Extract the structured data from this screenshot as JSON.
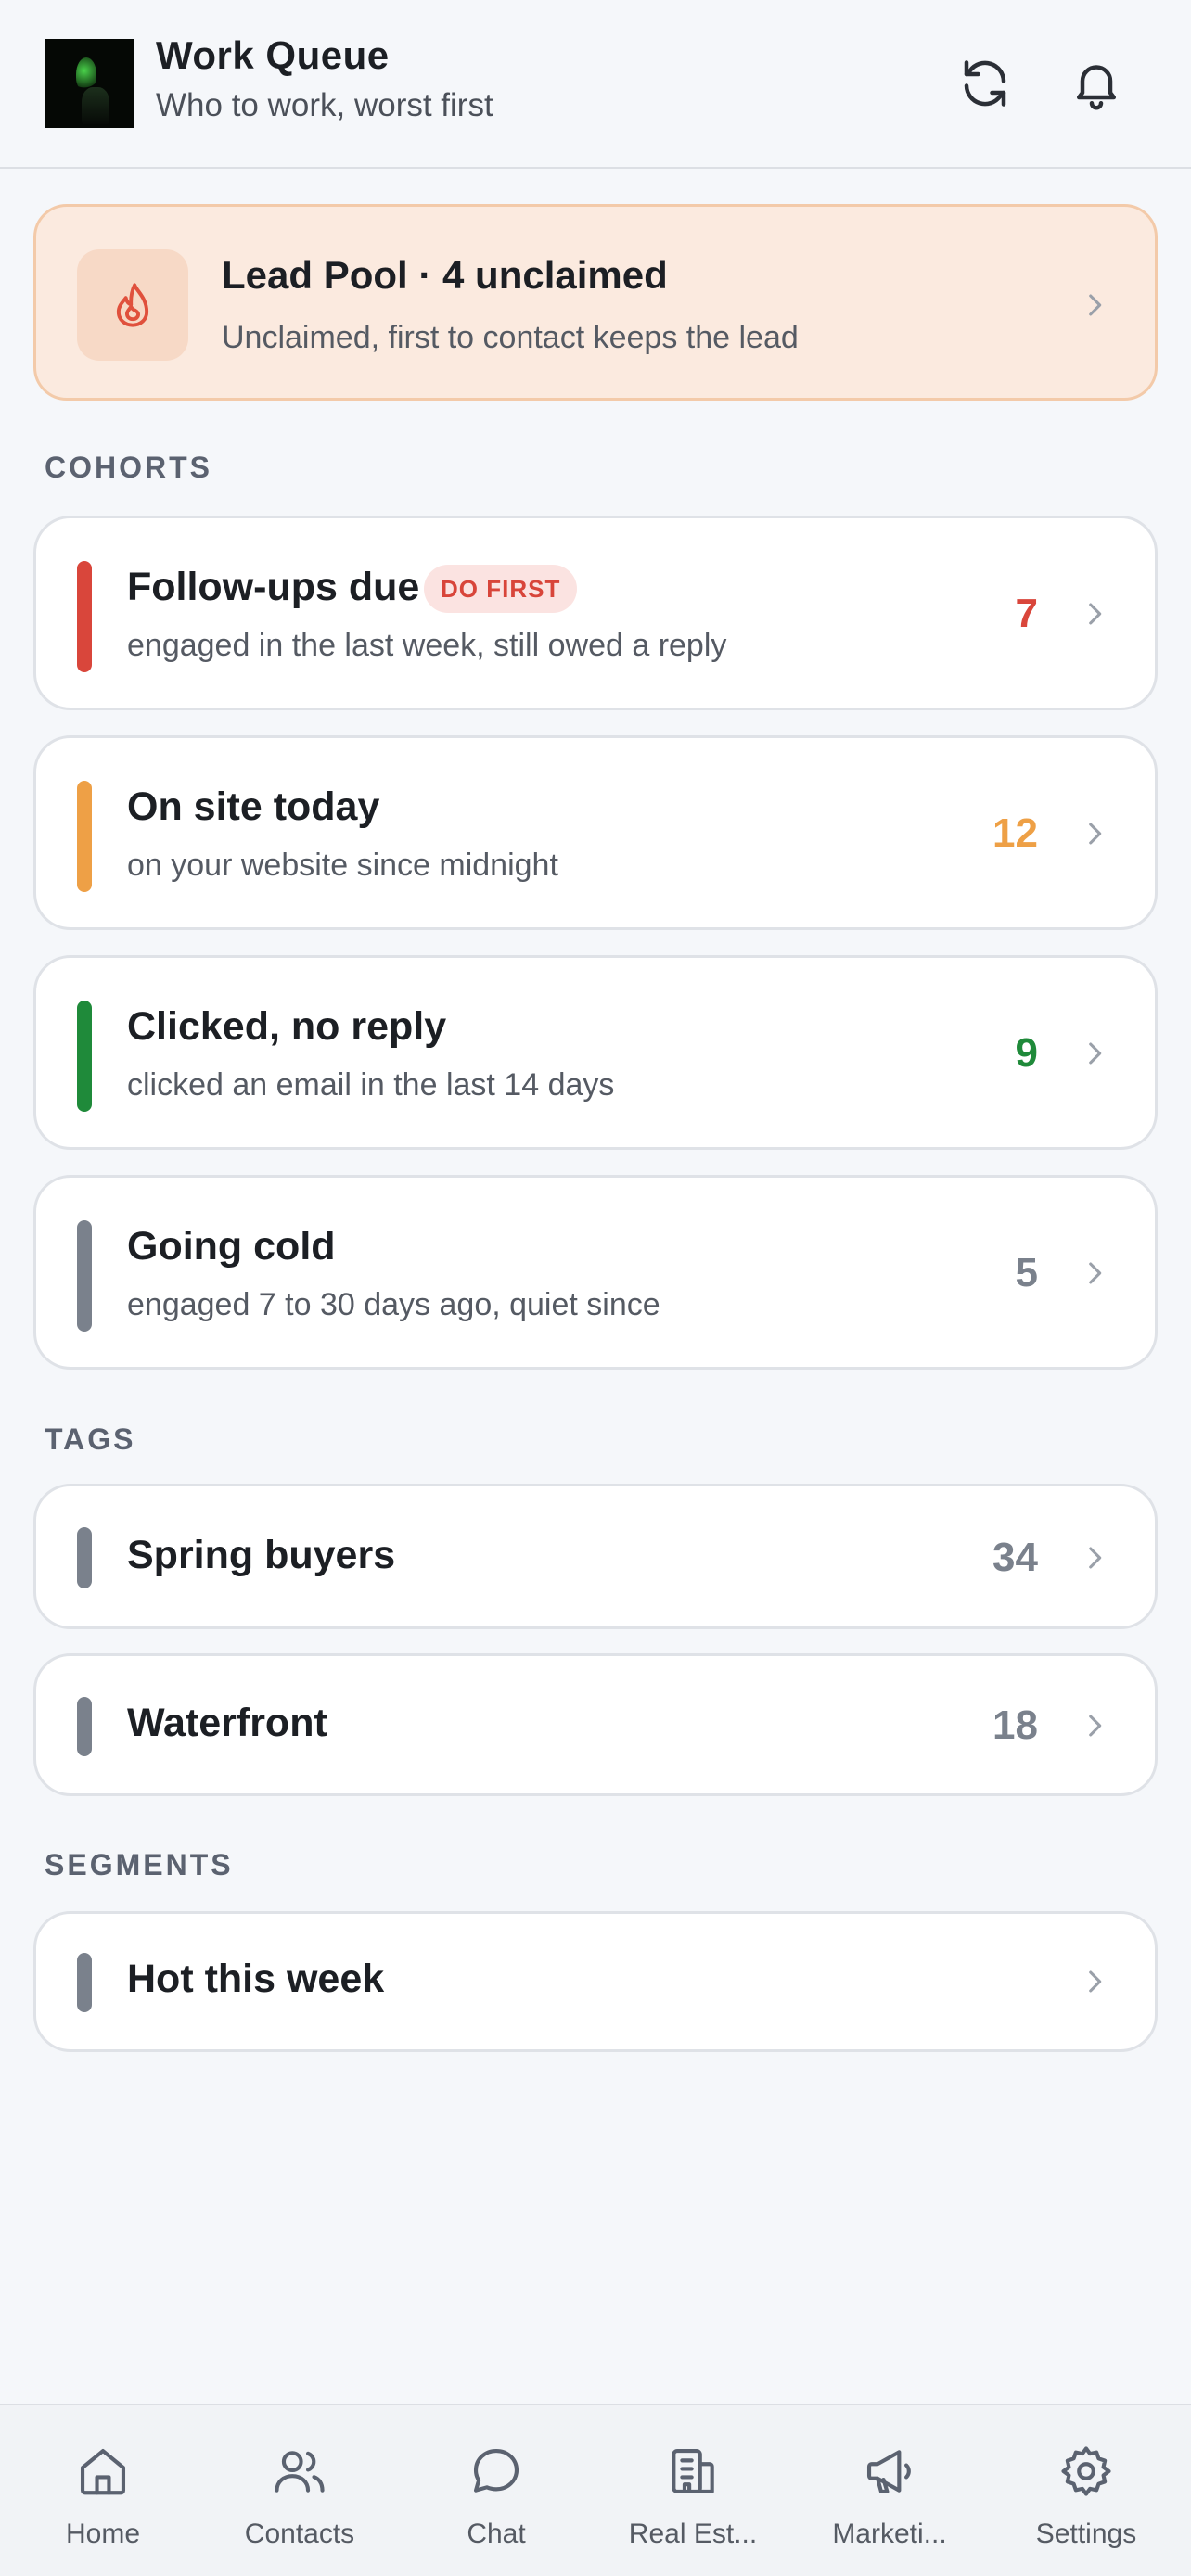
{
  "header": {
    "title": "Work Queue",
    "subtitle": "Who to work, worst first",
    "refresh_icon": "refresh-icon",
    "bell_icon": "bell-icon"
  },
  "lead_pool": {
    "title": "Lead Pool · 4 unclaimed",
    "subtitle": "Unclaimed, first to contact keeps the lead",
    "icon": "flame-icon",
    "accent": "#e0503c"
  },
  "sections": {
    "cohorts": "COHORTS",
    "tags": "TAGS",
    "segments": "SEGMENTS"
  },
  "cohorts": [
    {
      "title": "Follow-ups due",
      "badge": "DO FIRST",
      "subtitle": "engaged in the last week, still owed a reply",
      "count": "7",
      "color": "#d9463b"
    },
    {
      "title": "On site today",
      "subtitle": "on your website since midnight",
      "count": "12",
      "color": "#eea046"
    },
    {
      "title": "Clicked, no reply",
      "subtitle": "clicked an email in the last 14 days",
      "count": "9",
      "color": "#1f8a3a"
    },
    {
      "title": "Going cold",
      "subtitle": "engaged 7 to 30 days ago, quiet since",
      "count": "5",
      "color": "#7a818c"
    }
  ],
  "tags": [
    {
      "title": "Spring buyers",
      "count": "34",
      "color": "#7a818c"
    },
    {
      "title": "Waterfront",
      "count": "18",
      "color": "#7a818c"
    }
  ],
  "segments": [
    {
      "title": "Hot this week",
      "color": "#7a818c"
    }
  ],
  "tabbar": [
    {
      "label": "Home",
      "icon": "home-icon"
    },
    {
      "label": "Contacts",
      "icon": "contacts-icon"
    },
    {
      "label": "Chat",
      "icon": "chat-icon"
    },
    {
      "label": "Real Est...",
      "icon": "building-icon"
    },
    {
      "label": "Marketi...",
      "icon": "megaphone-icon"
    },
    {
      "label": "Settings",
      "icon": "gear-icon"
    }
  ]
}
